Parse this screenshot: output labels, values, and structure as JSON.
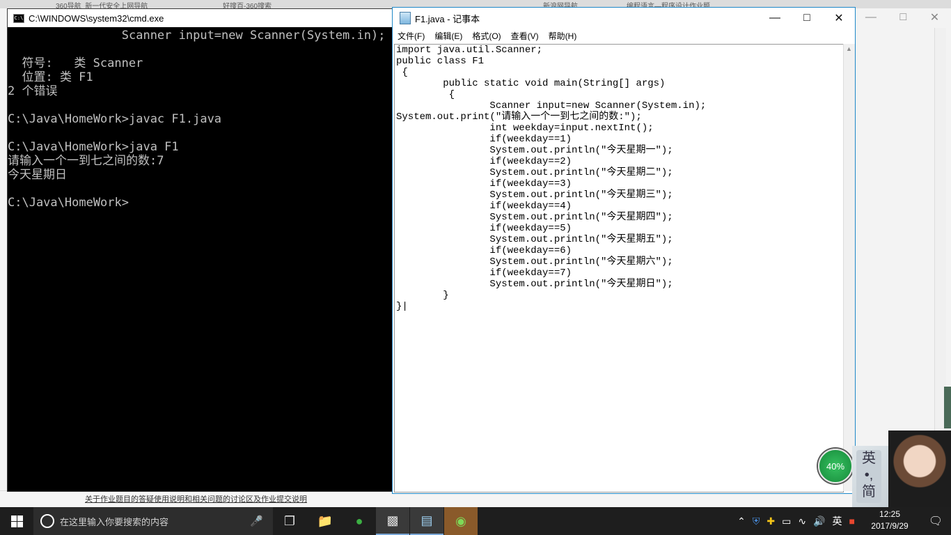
{
  "background": {
    "tabs": [
      "360导航_新一代安全上网导航",
      "好搜百-360搜索",
      "新浪网导航",
      "编程语言—程序设计作业题"
    ],
    "bottom_link": "关于作业题目的答疑使用说明和相关问题的讨论区及作业提交说明"
  },
  "cmd": {
    "title": "C:\\WINDOWS\\system32\\cmd.exe",
    "lines": [
      "                Scanner input=new Scanner(System.in);",
      "",
      "  符号:   类 Scanner",
      "  位置: 类 F1",
      "2 个错误",
      "",
      "C:\\Java\\HomeWork>javac F1.java",
      "",
      "C:\\Java\\HomeWork>java F1",
      "请输入一个一到七之间的数:7",
      "今天星期日",
      "",
      "C:\\Java\\HomeWork>"
    ]
  },
  "notepad": {
    "title": "F1.java - 记事本",
    "menu": [
      "文件(F)",
      "编辑(E)",
      "格式(O)",
      "查看(V)",
      "帮助(H)"
    ],
    "code": [
      "import java.util.Scanner;",
      "public class F1",
      " {",
      "        public static void main(String[] args)",
      "         {",
      "                Scanner input=new Scanner(System.in);",
      "System.out.print(\"请输入一个一到七之间的数:\");",
      "                int weekday=input.nextInt();",
      "                if(weekday==1)",
      "                System.out.println(\"今天星期一\");",
      "                if(weekday==2)",
      "                System.out.println(\"今天星期二\");",
      "                if(weekday==3)",
      "                System.out.println(\"今天星期三\");",
      "                if(weekday==4)",
      "                System.out.println(\"今天星期四\");",
      "                if(weekday==5)",
      "                System.out.println(\"今天星期五\");",
      "                if(weekday==6)",
      "                System.out.println(\"今天星期六\");",
      "                if(weekday==7)",
      "                System.out.println(\"今天星期日\");",
      "        }",
      "}|"
    ]
  },
  "taskbar": {
    "search_placeholder": "在这里输入你要搜索的内容",
    "tray_lang": "英",
    "time": "12:25",
    "date": "2017/9/29"
  },
  "overlay": {
    "battery_percent": "40%",
    "ime_top": "英",
    "ime_mid": "•,",
    "ime_bottom": "简"
  }
}
